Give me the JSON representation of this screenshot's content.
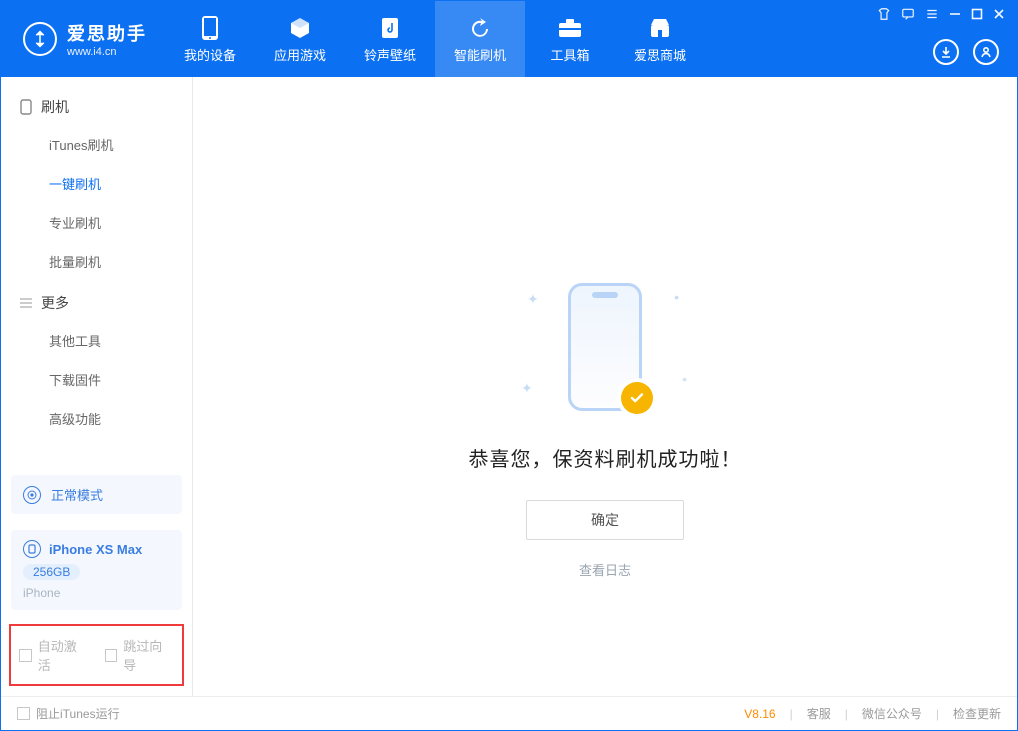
{
  "app": {
    "name": "爱思助手",
    "url": "www.i4.cn"
  },
  "nav": {
    "items": [
      {
        "label": "我的设备",
        "icon": "device-icon"
      },
      {
        "label": "应用游戏",
        "icon": "cube-icon"
      },
      {
        "label": "铃声壁纸",
        "icon": "music-icon"
      },
      {
        "label": "智能刷机",
        "icon": "refresh-icon",
        "active": true
      },
      {
        "label": "工具箱",
        "icon": "toolbox-icon"
      },
      {
        "label": "爱思商城",
        "icon": "store-icon"
      }
    ]
  },
  "sidebar": {
    "group1": {
      "title": "刷机",
      "items": [
        {
          "label": "iTunes刷机"
        },
        {
          "label": "一键刷机",
          "active": true
        },
        {
          "label": "专业刷机"
        },
        {
          "label": "批量刷机"
        }
      ]
    },
    "group2": {
      "title": "更多",
      "items": [
        {
          "label": "其他工具"
        },
        {
          "label": "下载固件"
        },
        {
          "label": "高级功能"
        }
      ]
    },
    "mode": {
      "label": "正常模式"
    },
    "device": {
      "name": "iPhone XS Max",
      "storage": "256GB",
      "type": "iPhone"
    },
    "options": {
      "auto_activate": "自动激活",
      "skip_guide": "跳过向导"
    }
  },
  "main": {
    "success_text": "恭喜您，保资料刷机成功啦！",
    "ok_label": "确定",
    "view_log": "查看日志"
  },
  "footer": {
    "block_itunes": "阻止iTunes运行",
    "version": "V8.16",
    "links": {
      "service": "客服",
      "wechat": "微信公众号",
      "update": "检查更新"
    }
  }
}
